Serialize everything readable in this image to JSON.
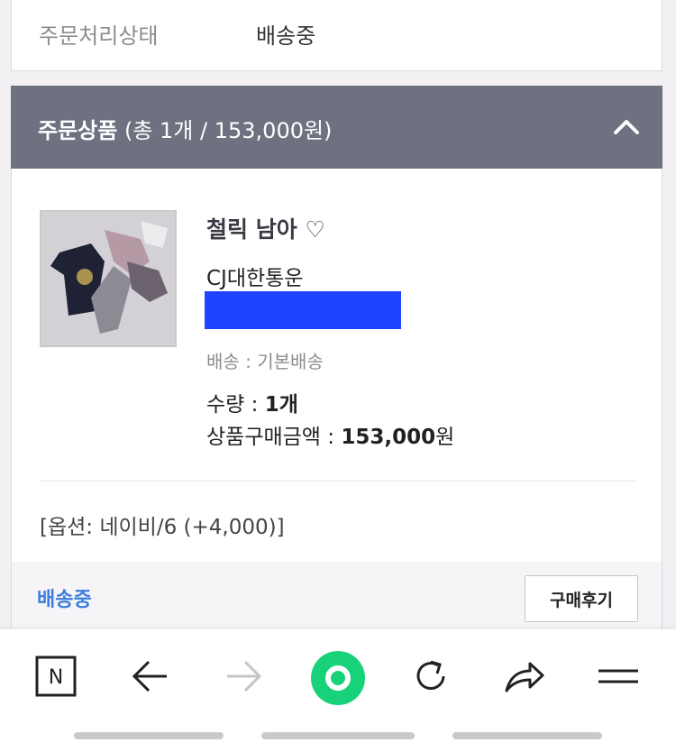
{
  "status": {
    "label": "주문처리상태",
    "value": "배송중"
  },
  "items_header": {
    "title": "주문상품",
    "summary": "(총 1개 / 153,000원)"
  },
  "product": {
    "name": "철릭 남아 ♡",
    "carrier": "CJ대한통운",
    "shipping": "배송 : 기본배송",
    "qty_label": "수량 : ",
    "qty_value": "1개",
    "price_label": "상품구매금액 : ",
    "price_value": "153,000",
    "price_unit": "원",
    "option": "[옵션: 네이비/6 (+4,000)]"
  },
  "footer": {
    "status": "배송중",
    "review_button": "구매후기"
  },
  "colors": {
    "header_bg": "#6e717f",
    "accent_blue": "#3d7fdc",
    "green": "#18d27a",
    "redaction": "#1f44ff"
  },
  "nav": {
    "icons": [
      "naver-n-icon",
      "back-arrow-icon",
      "forward-arrow-icon",
      "home-green-icon",
      "refresh-icon",
      "share-icon",
      "menu-icon"
    ],
    "home_label": "N"
  }
}
